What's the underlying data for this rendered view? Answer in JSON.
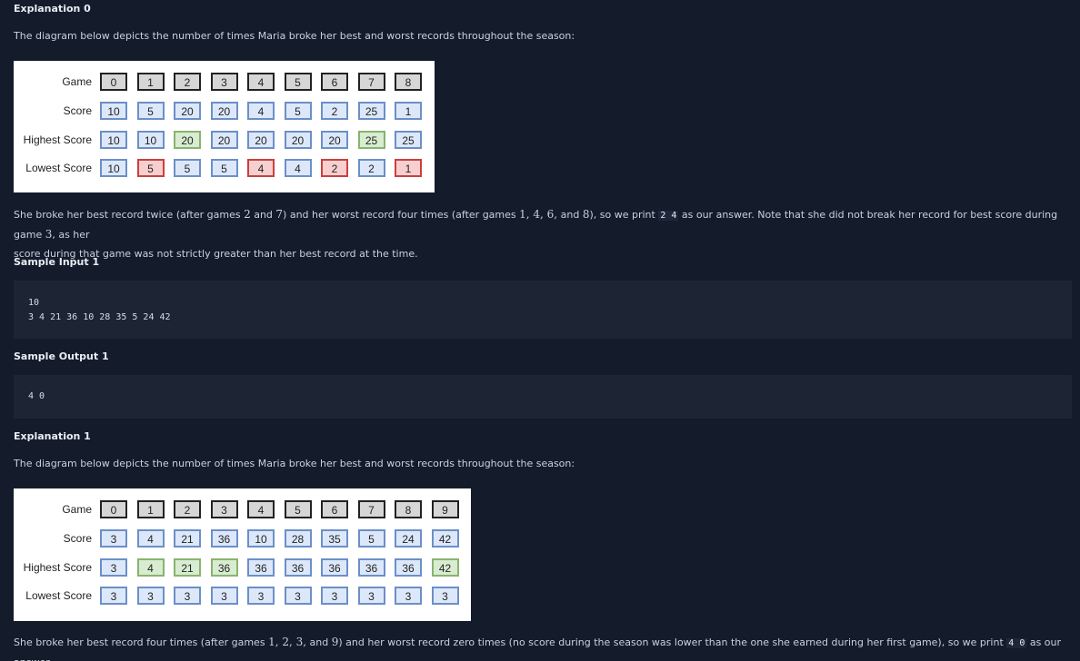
{
  "explanation0": {
    "heading": "Explanation 0",
    "intro": "The diagram below depicts the number of times Maria broke her best and worst records throughout the season:",
    "diagram": {
      "labels": [
        "Game",
        "Score",
        "Highest Score",
        "Lowest Score"
      ],
      "games": [
        "0",
        "1",
        "2",
        "3",
        "4",
        "5",
        "6",
        "7",
        "8"
      ],
      "scores": [
        "10",
        "5",
        "20",
        "20",
        "4",
        "5",
        "2",
        "25",
        "1"
      ],
      "highest": [
        "10",
        "10",
        "20",
        "20",
        "20",
        "20",
        "20",
        "25",
        "25"
      ],
      "lowest": [
        "10",
        "5",
        "5",
        "5",
        "4",
        "4",
        "2",
        "2",
        "1"
      ],
      "highest_broken": [
        2,
        7
      ],
      "lowest_broken": [
        1,
        4,
        6,
        8
      ]
    },
    "text": {
      "a": "She broke her best record twice (after games ",
      "n1": "2",
      "b": " and ",
      "n2": "7",
      "c": ") and her worst record four times (after games ",
      "n3": "1, 4, 6,",
      "d": " and ",
      "n4": "8",
      "e": "), so we print ",
      "code": "2 4",
      "f": " as our answer. Note that she did not break her record for best score during game ",
      "n5": "3",
      "g": ", as her",
      "line2": "score during that game was not strictly greater than her best record at the time."
    }
  },
  "sample_input_1": {
    "heading": "Sample Input 1",
    "lines": [
      "10",
      "3 4 21 36 10 28 35 5 24 42"
    ]
  },
  "sample_output_1": {
    "heading": "Sample Output 1",
    "lines": [
      "4 0"
    ]
  },
  "explanation1": {
    "heading": "Explanation 1",
    "intro": "The diagram below depicts the number of times Maria broke her best and worst records throughout the season:",
    "diagram": {
      "labels": [
        "Game",
        "Score",
        "Highest Score",
        "Lowest Score"
      ],
      "games": [
        "0",
        "1",
        "2",
        "3",
        "4",
        "5",
        "6",
        "7",
        "8",
        "9"
      ],
      "scores": [
        "3",
        "4",
        "21",
        "36",
        "10",
        "28",
        "35",
        "5",
        "24",
        "42"
      ],
      "highest": [
        "3",
        "4",
        "21",
        "36",
        "36",
        "36",
        "36",
        "36",
        "36",
        "42"
      ],
      "lowest": [
        "3",
        "3",
        "3",
        "3",
        "3",
        "3",
        "3",
        "3",
        "3",
        "3"
      ],
      "highest_broken": [
        1,
        2,
        3,
        9
      ],
      "lowest_broken": []
    },
    "text": {
      "a": "She broke her best record four times (after games ",
      "n1": "1, 2, 3,",
      "b": " and ",
      "n2": "9",
      "c": ") and her worst record zero times (no score during the season was lower than the one she earned during her first game), so we print ",
      "code": "4 0",
      "d": " as our answer."
    }
  }
}
